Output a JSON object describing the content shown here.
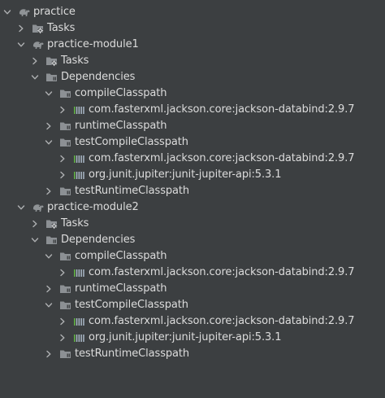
{
  "icons": {
    "chevron_down": "chevron-down-icon",
    "chevron_right": "chevron-right-icon",
    "gradle": "gradle-elephant-icon",
    "tasks": "tasks-folder-gear-icon",
    "folder": "folder-icon",
    "library": "library-jar-icon"
  },
  "colors": {
    "background": "#3c3f41",
    "text": "#dcdcdc",
    "chevron": "#aeb0b2",
    "gradle": "#8f9396",
    "folder": "#8c9094",
    "library_bars": "#a9b7c6",
    "library_accent": "#62b543"
  },
  "tree": [
    {
      "name": "project-practice",
      "depth": 0,
      "chevron": "down",
      "icon": "gradle",
      "label": "practice"
    },
    {
      "name": "tasks-practice",
      "depth": 1,
      "chevron": "right",
      "icon": "tasks",
      "label": "Tasks"
    },
    {
      "name": "module-practice-module1",
      "depth": 1,
      "chevron": "down",
      "icon": "gradle",
      "label": "practice-module1"
    },
    {
      "name": "tasks-module1",
      "depth": 2,
      "chevron": "right",
      "icon": "tasks",
      "label": "Tasks"
    },
    {
      "name": "dependencies-module1",
      "depth": 2,
      "chevron": "down",
      "icon": "folder",
      "label": "Dependencies"
    },
    {
      "name": "compile-classpath-module1",
      "depth": 3,
      "chevron": "down",
      "icon": "folder",
      "label": "compileClasspath"
    },
    {
      "name": "dep-jackson-compile-module1",
      "depth": 4,
      "chevron": "right",
      "icon": "library",
      "label": "com.fasterxml.jackson.core:jackson-databind:2.9.7"
    },
    {
      "name": "runtime-classpath-module1",
      "depth": 3,
      "chevron": "right",
      "icon": "folder",
      "label": "runtimeClasspath"
    },
    {
      "name": "test-compile-classpath-module1",
      "depth": 3,
      "chevron": "down",
      "icon": "folder",
      "label": "testCompileClasspath"
    },
    {
      "name": "dep-jackson-testcompile-module1",
      "depth": 4,
      "chevron": "right",
      "icon": "library",
      "label": "com.fasterxml.jackson.core:jackson-databind:2.9.7"
    },
    {
      "name": "dep-junit-testcompile-module1",
      "depth": 4,
      "chevron": "right",
      "icon": "library",
      "label": "org.junit.jupiter:junit-jupiter-api:5.3.1"
    },
    {
      "name": "test-runtime-classpath-module1",
      "depth": 3,
      "chevron": "right",
      "icon": "folder",
      "label": "testRuntimeClasspath"
    },
    {
      "name": "module-practice-module2",
      "depth": 1,
      "chevron": "down",
      "icon": "gradle",
      "label": "practice-module2"
    },
    {
      "name": "tasks-module2",
      "depth": 2,
      "chevron": "right",
      "icon": "tasks",
      "label": "Tasks"
    },
    {
      "name": "dependencies-module2",
      "depth": 2,
      "chevron": "down",
      "icon": "folder",
      "label": "Dependencies"
    },
    {
      "name": "compile-classpath-module2",
      "depth": 3,
      "chevron": "down",
      "icon": "folder",
      "label": "compileClasspath"
    },
    {
      "name": "dep-jackson-compile-module2",
      "depth": 4,
      "chevron": "right",
      "icon": "library",
      "label": "com.fasterxml.jackson.core:jackson-databind:2.9.7"
    },
    {
      "name": "runtime-classpath-module2",
      "depth": 3,
      "chevron": "right",
      "icon": "folder",
      "label": "runtimeClasspath"
    },
    {
      "name": "test-compile-classpath-module2",
      "depth": 3,
      "chevron": "down",
      "icon": "folder",
      "label": "testCompileClasspath"
    },
    {
      "name": "dep-jackson-testcompile-module2",
      "depth": 4,
      "chevron": "right",
      "icon": "library",
      "label": "com.fasterxml.jackson.core:jackson-databind:2.9.7"
    },
    {
      "name": "dep-junit-testcompile-module2",
      "depth": 4,
      "chevron": "right",
      "icon": "library",
      "label": "org.junit.jupiter:junit-jupiter-api:5.3.1"
    },
    {
      "name": "test-runtime-classpath-module2",
      "depth": 3,
      "chevron": "right",
      "icon": "folder",
      "label": "testRuntimeClasspath"
    }
  ]
}
